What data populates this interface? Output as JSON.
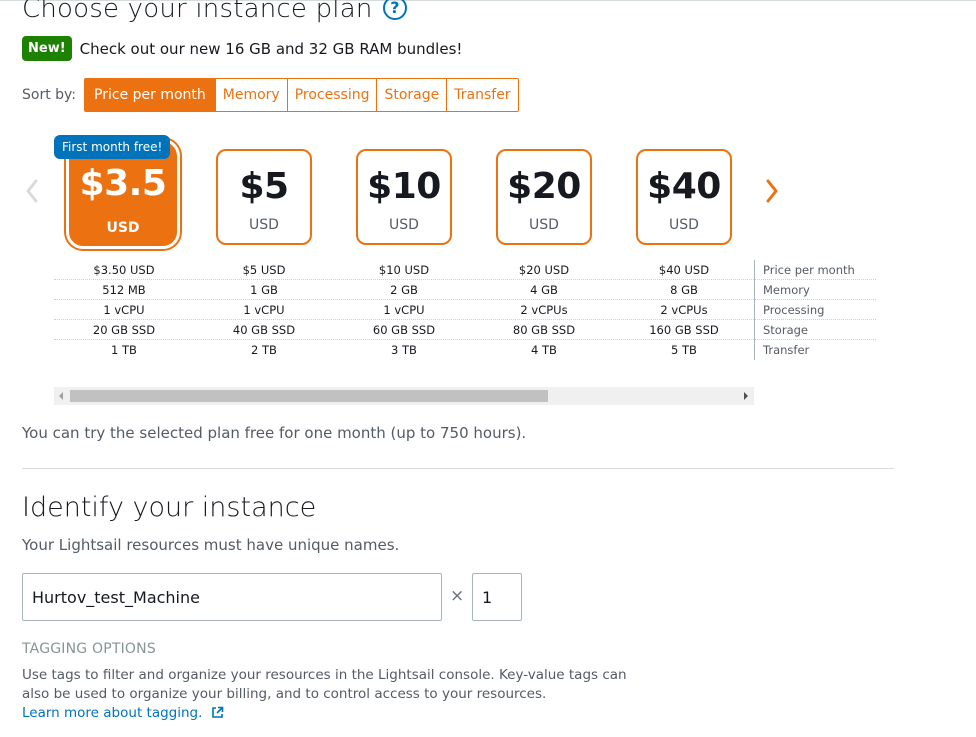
{
  "plan_section": {
    "title": "Choose your instance plan",
    "new_badge": "New!",
    "new_text": "Check out our new 16 GB and 32 GB RAM bundles!",
    "sort_label": "Sort by:",
    "sort_options": [
      "Price per month",
      "Memory",
      "Processing",
      "Storage",
      "Transfer"
    ],
    "sort_selected": "Price per month",
    "free_badge": "First month free!",
    "plans": [
      {
        "price": "$3.5",
        "currency": "USD",
        "selected": true,
        "specs": [
          "$3.50 USD",
          "512 MB",
          "1 vCPU",
          "20 GB SSD",
          "1 TB"
        ]
      },
      {
        "price": "$5",
        "currency": "USD",
        "selected": false,
        "specs": [
          "$5 USD",
          "1 GB",
          "1 vCPU",
          "40 GB SSD",
          "2 TB"
        ]
      },
      {
        "price": "$10",
        "currency": "USD",
        "selected": false,
        "specs": [
          "$10 USD",
          "2 GB",
          "1 vCPU",
          "60 GB SSD",
          "3 TB"
        ]
      },
      {
        "price": "$20",
        "currency": "USD",
        "selected": false,
        "specs": [
          "$20 USD",
          "4 GB",
          "2 vCPUs",
          "80 GB SSD",
          "4 TB"
        ]
      },
      {
        "price": "$40",
        "currency": "USD",
        "selected": false,
        "specs": [
          "$40 USD",
          "8 GB",
          "2 vCPUs",
          "160 GB SSD",
          "5 TB"
        ]
      }
    ],
    "spec_labels": [
      "Price per month",
      "Memory",
      "Processing",
      "Storage",
      "Transfer"
    ],
    "free_note": "You can try the selected plan free for one month (up to 750 hours)."
  },
  "identify_section": {
    "title": "Identify your instance",
    "subtitle": "Your Lightsail resources must have unique names.",
    "name_value": "Hurtov_test_Machine",
    "multiplier": "×",
    "quantity_value": "1"
  },
  "tagging": {
    "heading": "TAGGING OPTIONS",
    "description": "Use tags to filter and organize your resources in the Lightsail console. Key-value tags can also be used to organize your billing, and to control access to your resources.",
    "link_text": "Learn more about tagging."
  },
  "colors": {
    "accent": "#ec7211",
    "link": "#0073bb",
    "new_badge": "#1d8102"
  },
  "icons": {
    "help": "help-circle-icon",
    "prev": "chevron-left-icon",
    "next": "chevron-right-icon",
    "external": "external-link-icon"
  }
}
